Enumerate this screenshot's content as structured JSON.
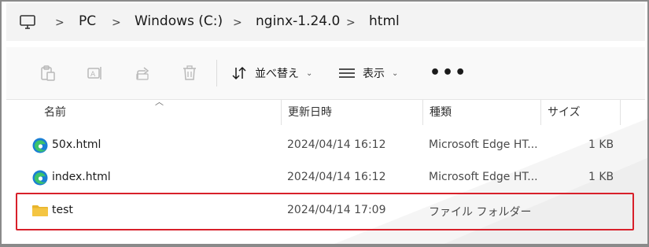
{
  "breadcrumb": {
    "items": [
      "PC",
      "Windows (C:)",
      "nginx-1.24.0",
      "html"
    ],
    "separator": ">"
  },
  "toolbar": {
    "sort_label": "並べ替え",
    "view_label": "表示",
    "more_label": "•••",
    "chevron": "⌄"
  },
  "columns": {
    "name": "名前",
    "date": "更新日時",
    "type": "種類",
    "size": "サイズ"
  },
  "files": [
    {
      "name": "50x.html",
      "date": "2024/04/14 16:12",
      "type": "Microsoft Edge HT...",
      "size": "1 KB",
      "icon": "edge-html-icon"
    },
    {
      "name": "index.html",
      "date": "2024/04/14 16:12",
      "type": "Microsoft Edge HT...",
      "size": "1 KB",
      "icon": "edge-html-icon"
    },
    {
      "name": "test",
      "date": "2024/04/14 17:09",
      "type": "ファイル フォルダー",
      "size": "",
      "icon": "folder-icon"
    }
  ],
  "colors": {
    "highlight": "#d8202a",
    "folder": "#f4c542",
    "edge_blue": "#1a7fd4",
    "edge_green": "#3cc36b"
  }
}
